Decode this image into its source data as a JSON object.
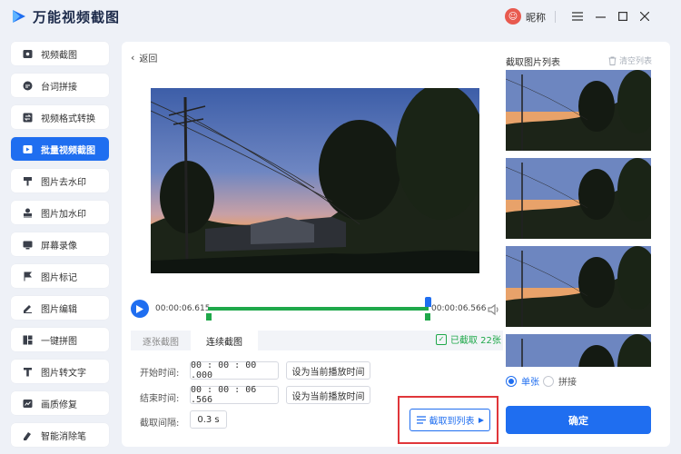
{
  "app": {
    "title": "万能视频截图",
    "nickname": "昵称",
    "avatar_glyph": "☺"
  },
  "sidebar": {
    "items": [
      {
        "label": "视频截图",
        "icon": "image-icon"
      },
      {
        "label": "台词拼接",
        "icon": "subtitle-icon"
      },
      {
        "label": "视频格式转换",
        "icon": "convert-icon"
      },
      {
        "label": "批量视频截图",
        "icon": "batch-icon",
        "active": true
      },
      {
        "label": "图片去水印",
        "icon": "erase-icon"
      },
      {
        "label": "图片加水印",
        "icon": "stamp-icon"
      },
      {
        "label": "屏幕录像",
        "icon": "record-icon"
      },
      {
        "label": "图片标记",
        "icon": "flag-icon"
      },
      {
        "label": "图片编辑",
        "icon": "edit-icon"
      },
      {
        "label": "一键拼图",
        "icon": "collage-icon"
      },
      {
        "label": "图片转文字",
        "icon": "text-icon"
      },
      {
        "label": "画质修复",
        "icon": "repair-icon"
      },
      {
        "label": "智能消除笔",
        "icon": "eraser-pen-icon"
      }
    ]
  },
  "main": {
    "back_label": "返回",
    "player": {
      "current_time": "00:00:06.615",
      "end_time": "00:00:06.566"
    },
    "tabs": [
      {
        "label": "逐张截图"
      },
      {
        "label": "连续截图",
        "active": true
      }
    ],
    "captured_label": "已截取 22张",
    "form": {
      "start_label": "开始时间:",
      "start_value": "00 : 00 : 00 .000",
      "end_label": "结束时间:",
      "end_value": "00 : 00 : 06 .566",
      "set_current_label": "设为当前播放时间",
      "interval_label": "截取间隔:",
      "interval_value": "0.3  s"
    },
    "capture_to_list_label": "截取到列表"
  },
  "right_panel": {
    "title": "截取图片列表",
    "clear_label": "清空列表",
    "options": [
      {
        "label": "单张",
        "selected": true
      },
      {
        "label": "拼接",
        "selected": false
      }
    ],
    "confirm_label": "确定",
    "thumbnail_count": 4
  },
  "colors": {
    "accent": "#1f6ef0",
    "success": "#1fa84a",
    "highlight": "#e0363a"
  }
}
